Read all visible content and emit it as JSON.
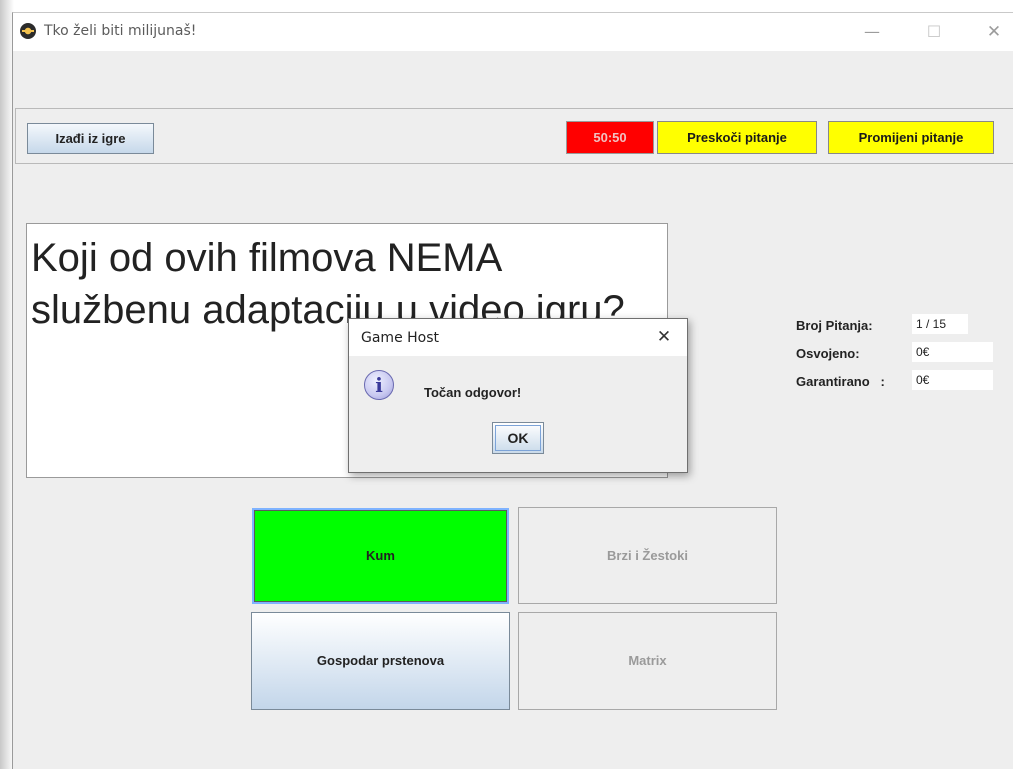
{
  "window": {
    "title": "Tko želi biti milijunaš!",
    "controls": {
      "minimize": "—",
      "maximize": "☐",
      "close": "✕"
    }
  },
  "toolbar": {
    "exit_label": "Izađi iz igre",
    "fifty_fifty_label": "50:50",
    "skip_label": "Preskoči pitanje",
    "change_label": "Promijeni pitanje"
  },
  "question": {
    "text": "Koji od ovih filmova NEMA službenu adaptaciju u video igru?"
  },
  "answers": [
    {
      "label": "Kum",
      "state": "correct"
    },
    {
      "label": "Brzi i Žestoki",
      "state": "disabled"
    },
    {
      "label": "Gospodar prstenova",
      "state": "enabled"
    },
    {
      "label": "Matrix",
      "state": "disabled"
    }
  ],
  "stats": {
    "question_number_label": "Broj Pitanja:",
    "question_number_value": "1 / 15",
    "won_label": "Osvojeno:",
    "won_value": "0€",
    "guaranteed_label": "Garantirano   :",
    "guaranteed_value": "0€"
  },
  "dialog": {
    "title": "Game Host",
    "close": "✕",
    "message": "Točan odgovor!",
    "ok_label": "OK"
  },
  "colors": {
    "correct_answer": "#00ff00",
    "fifty_fifty_used": "#ff0000",
    "lifeline_available": "#ffff00",
    "window_bg": "#eeeeee"
  }
}
